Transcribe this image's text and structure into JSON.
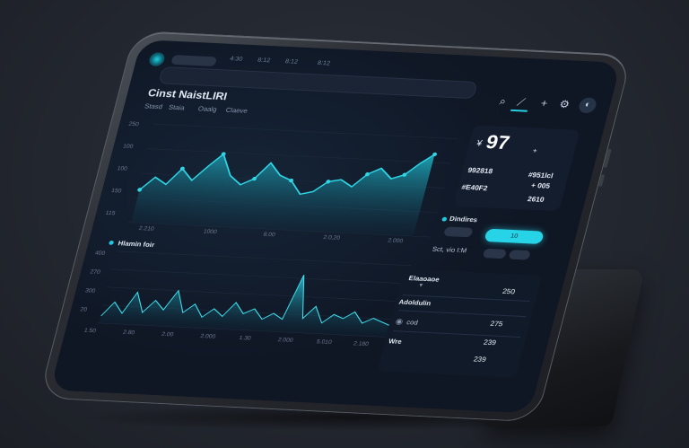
{
  "header": {
    "nav_items": [
      "4:30",
      "8:12",
      "8:12",
      "8:12"
    ],
    "title": "Cinst NaistLIRI",
    "subtabs": [
      "Stasd",
      "Staia",
      "Oaalg",
      "Claeve"
    ]
  },
  "main_chart": {
    "y_ticks": [
      "250",
      "100",
      "100",
      "150",
      "115"
    ],
    "x_ticks": [
      "2.210",
      "1000",
      "8.00",
      "2.0,20",
      "2.000"
    ],
    "corner_label": "",
    "stroke": "#2fd6e6"
  },
  "second_chart": {
    "title": "Hlamin foir",
    "y_ticks": [
      "400",
      "270",
      "300",
      "20"
    ],
    "x_ticks": [
      "1.50",
      "2.80",
      "2.00",
      "2.000",
      "1.30",
      "2.000",
      "5.010",
      "2.180"
    ]
  },
  "stats": {
    "currency": "¥",
    "big_value": "97",
    "plus": "+",
    "row1_left": "992818",
    "row1_right": "#951lcl",
    "row2_left": "#E40F2",
    "row2_right": "+ 005",
    "row3_right": "2610"
  },
  "controls": {
    "title": "Dindires",
    "button_small": "",
    "button_label": "10",
    "row_label": "Sct, vio I:M"
  },
  "list": {
    "rows": [
      {
        "label": "Elaaoaoe",
        "value": "250"
      },
      {
        "label": "Adoldulin",
        "value": "275"
      },
      {
        "label": "cod",
        "value": "239"
      },
      {
        "label": "Wre",
        "value": "239"
      }
    ]
  },
  "icons": [
    "logo-icon",
    "search-icon",
    "chart-icon",
    "plus-icon",
    "settings-icon",
    "profile-icon"
  ],
  "colors": {
    "accent": "#27d3e6",
    "bg": "#0f1624",
    "card": "#141d2e"
  },
  "chart_data": [
    {
      "type": "area",
      "title": "",
      "xlabel": "",
      "ylabel": "",
      "x": [
        0,
        1,
        2,
        3,
        4,
        5,
        6,
        7,
        8,
        9,
        10,
        11,
        12,
        13,
        14,
        15,
        16,
        17,
        18,
        19,
        20,
        21,
        22,
        23
      ],
      "series": [
        {
          "values": [
            150,
            170,
            160,
            185,
            168,
            190,
            210,
            178,
            165,
            175,
            200,
            182,
            175,
            155,
            160,
            176,
            180,
            170,
            190,
            200,
            185,
            192,
            210,
            225
          ]
        }
      ],
      "ylim": [
        100,
        250
      ]
    },
    {
      "type": "area",
      "title": "Hlamin foir",
      "xlabel": "",
      "ylabel": "",
      "series": [
        {
          "values": [
            40,
            120,
            60,
            180,
            70,
            140,
            90,
            200,
            80,
            130,
            60,
            110,
            70,
            150,
            90,
            120,
            65,
            100,
            70,
            320,
            80,
            150,
            60,
            110,
            90,
            130,
            70,
            100,
            80,
            60
          ]
        }
      ],
      "ylim": [
        0,
        400
      ]
    }
  ]
}
